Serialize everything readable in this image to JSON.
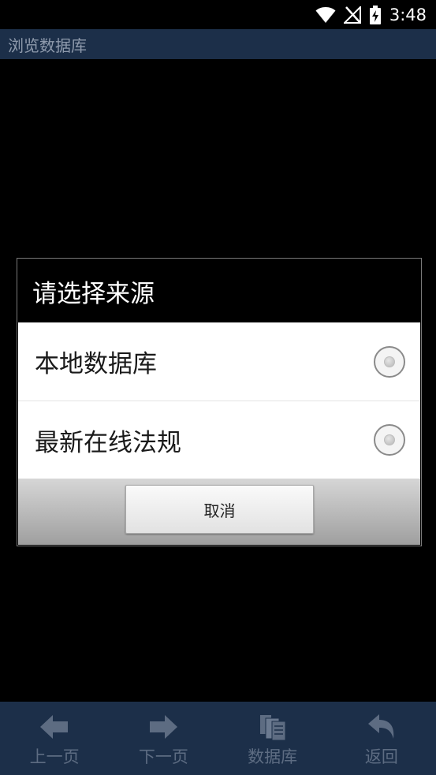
{
  "status_bar": {
    "time": "3:48",
    "icons": [
      "wifi-icon",
      "no-signal-icon",
      "battery-charging-icon"
    ]
  },
  "app": {
    "title": "浏览数据库"
  },
  "dialog": {
    "title": "请选择来源",
    "options": [
      {
        "label": "本地数据库",
        "selected": false
      },
      {
        "label": "最新在线法规",
        "selected": false
      }
    ],
    "cancel_label": "取消"
  },
  "toolbar": {
    "items": [
      {
        "label": "上一页",
        "icon": "arrow-left-icon"
      },
      {
        "label": "下一页",
        "icon": "arrow-right-icon"
      },
      {
        "label": "数据库",
        "icon": "database-icon"
      },
      {
        "label": "返回",
        "icon": "back-icon"
      }
    ]
  },
  "colors": {
    "title_bar": "#1c2f49",
    "title_text": "#8e9aac",
    "toolbar_icon": "#5d6c82"
  }
}
